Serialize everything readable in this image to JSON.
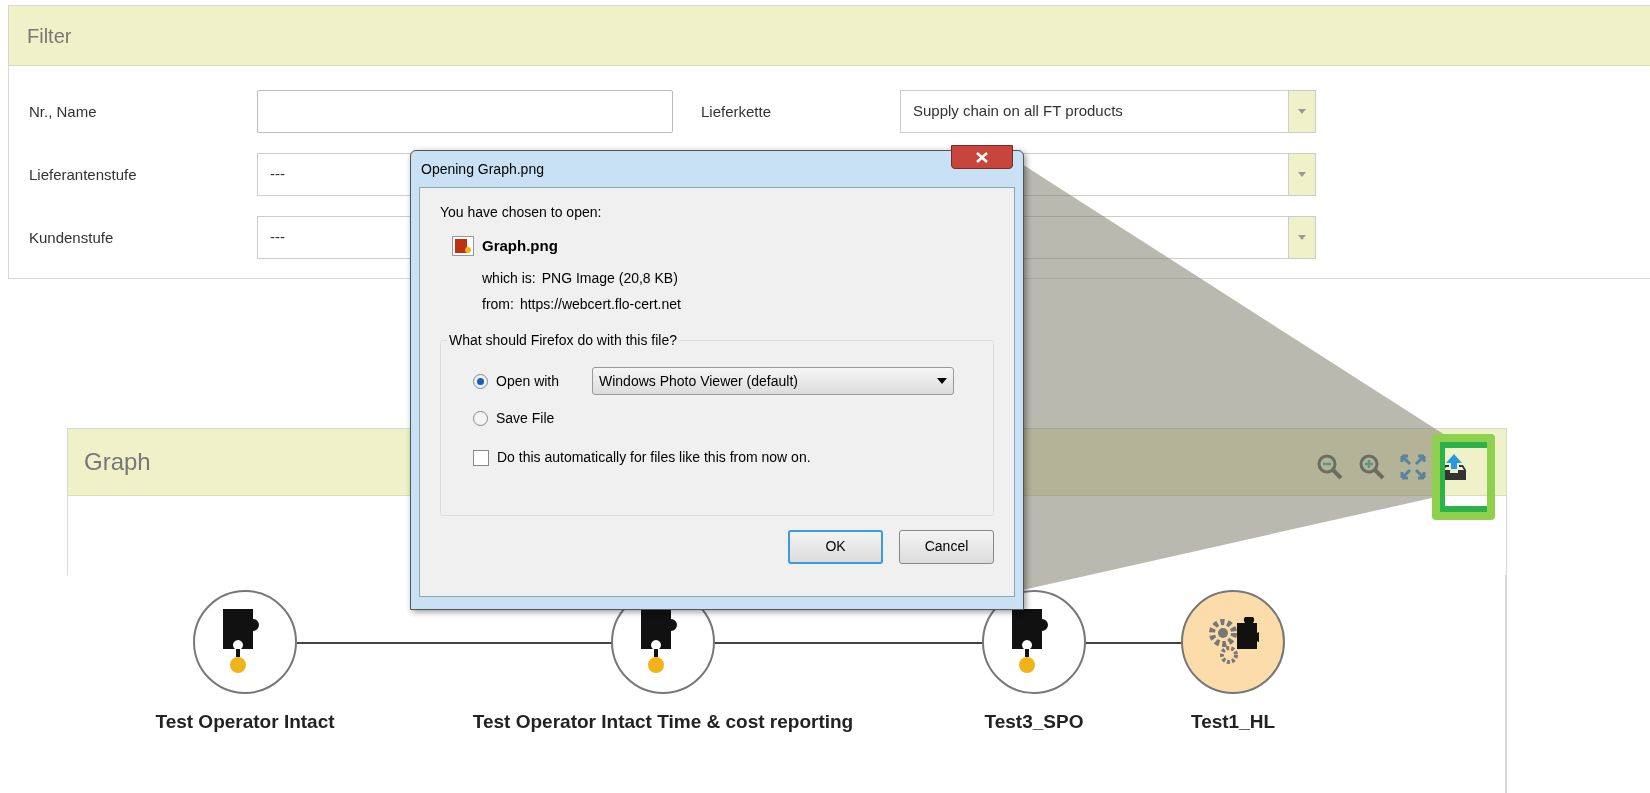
{
  "filter": {
    "title": "Filter",
    "rows": [
      [
        {
          "label": "Nr., Name",
          "kind": "input"
        },
        {
          "label": "Lieferkette",
          "kind": "select",
          "value": "Supply chain on all FT products"
        }
      ],
      [
        {
          "label": "Lieferantenstufe",
          "kind": "select",
          "value": "---"
        },
        {
          "kind": "select"
        }
      ],
      [
        {
          "label": "Kundenstufe",
          "kind": "select",
          "value": "---"
        },
        {
          "kind": "select"
        }
      ]
    ]
  },
  "graph": {
    "title": "Graph",
    "nodes": [
      {
        "label": "Test Operator Intact",
        "kind": "puzzle"
      },
      {
        "label": "Test Operator Intact Time & cost reporting",
        "kind": "puzzle"
      },
      {
        "label": "Test3_SPO",
        "kind": "puzzle"
      },
      {
        "label": "Test1_HL",
        "kind": "gears"
      }
    ]
  },
  "dialog": {
    "title": "Opening Graph.png",
    "intro": "You have chosen to open:",
    "file_name": "Graph.png",
    "details": [
      {
        "label": "which is:",
        "value": "PNG Image (20,8 KB)"
      },
      {
        "label": "from:",
        "value": "https://webcert.flo-cert.net"
      }
    ],
    "question": "What should Firefox do with this file?",
    "options": [
      {
        "label": "Open with",
        "selected": true,
        "app": "Windows Photo Viewer (default)"
      },
      {
        "label": "Save File",
        "selected": false
      }
    ],
    "auto_checkbox": {
      "label": "Do this automatically for files like this from now on.",
      "checked": false
    },
    "buttons": [
      "OK",
      "Cancel"
    ]
  }
}
